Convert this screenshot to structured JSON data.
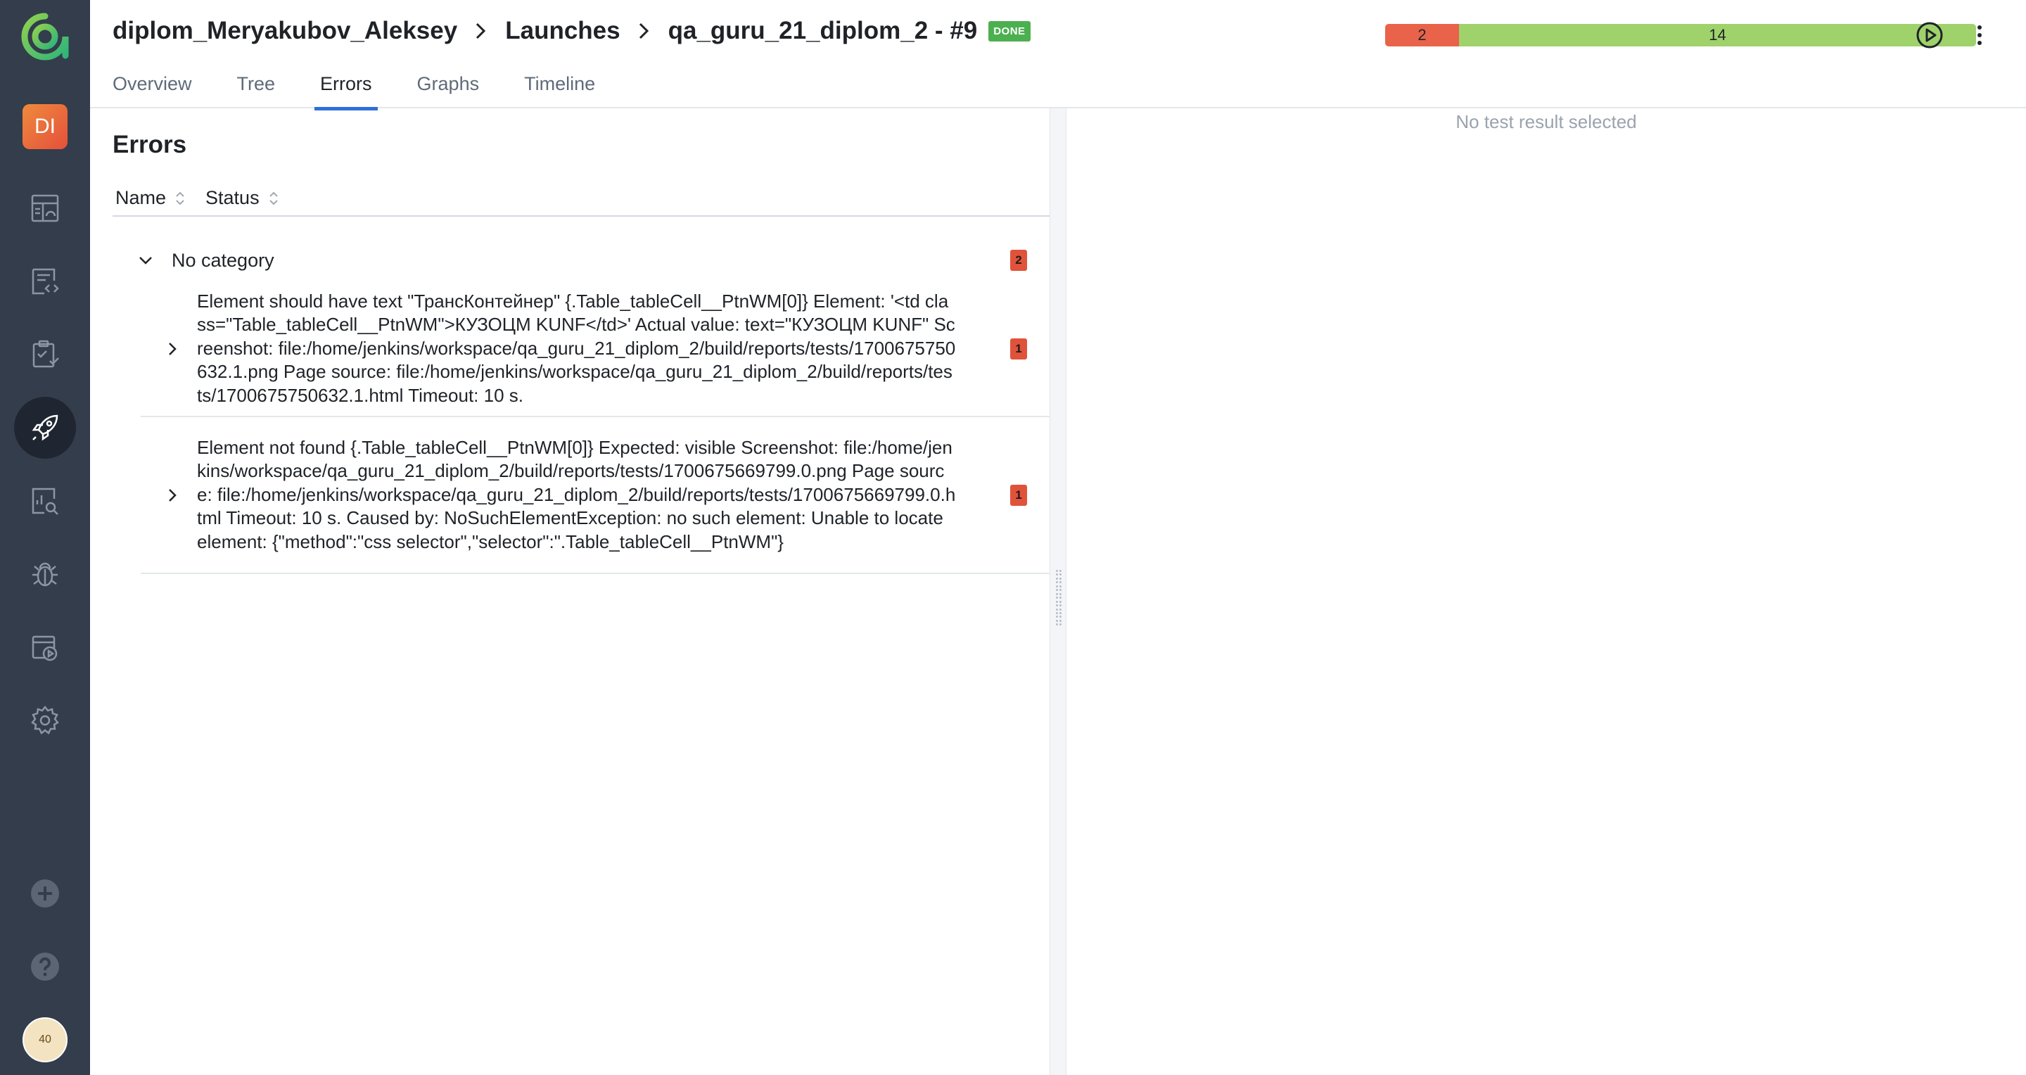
{
  "header": {
    "breadcrumbs": [
      "diplom_Meryakubov_Aleksey",
      "Launches",
      "qa_guru_21_diplom_2 - #9"
    ],
    "status_badge": "DONE",
    "stats": [
      {
        "label": "2",
        "value": 2,
        "color": "#e8634a"
      },
      {
        "label": "14",
        "value": 14,
        "color": "#9fd26b"
      }
    ],
    "actions": [
      "play-icon",
      "more-vertical-icon"
    ]
  },
  "tabs": [
    {
      "label": "Overview",
      "active": false
    },
    {
      "label": "Tree",
      "active": false
    },
    {
      "label": "Errors",
      "active": true
    },
    {
      "label": "Graphs",
      "active": false
    },
    {
      "label": "Timeline",
      "active": false
    }
  ],
  "sidebar": {
    "project_initials": "DI",
    "items": [
      "dashboard-icon",
      "test-cases-icon",
      "test-plans-icon",
      "launches-icon",
      "analytics-icon",
      "defects-icon",
      "jobs-icon",
      "settings-icon"
    ],
    "bottom": [
      "add-icon",
      "help-icon",
      "avatar"
    ],
    "avatar_text": "40"
  },
  "errors": {
    "title": "Errors",
    "columns": [
      "Name",
      "Status"
    ],
    "category": {
      "label": "No category",
      "count": "2"
    },
    "rows": [
      {
        "text": "Element should have text \"ТрансКонтейнер\" {.Table_tableCell__PtnWM[0]} Element: '<td class=\"Table_tableCell__PtnWM\">КУЗОЦМ KUNF</td>' Actual value: text=\"КУЗОЦМ KUNF\" Screenshot: file:/home/jenkins/workspace/qa_guru_21_diplom_2/build/reports/tests/1700675750632.1.png Page source: file:/home/jenkins/workspace/qa_guru_21_diplom_2/build/reports/tests/1700675750632.1.html Timeout: 10 s.",
        "count": "1"
      },
      {
        "text": "Element not found {.Table_tableCell__PtnWM[0]} Expected: visible Screenshot: file:/home/jenkins/workspace/qa_guru_21_diplom_2/build/reports/tests/1700675669799.0.png Page source: file:/home/jenkins/workspace/qa_guru_21_diplom_2/build/reports/tests/1700675669799.0.html Timeout: 10 s. Caused by: NoSuchElementException: no such element: Unable to locate element: {\"method\":\"css selector\",\"selector\":\".Table_tableCell__PtnWM\"}",
        "count": "1"
      }
    ]
  },
  "detail": {
    "empty_message": "No test result selected"
  }
}
